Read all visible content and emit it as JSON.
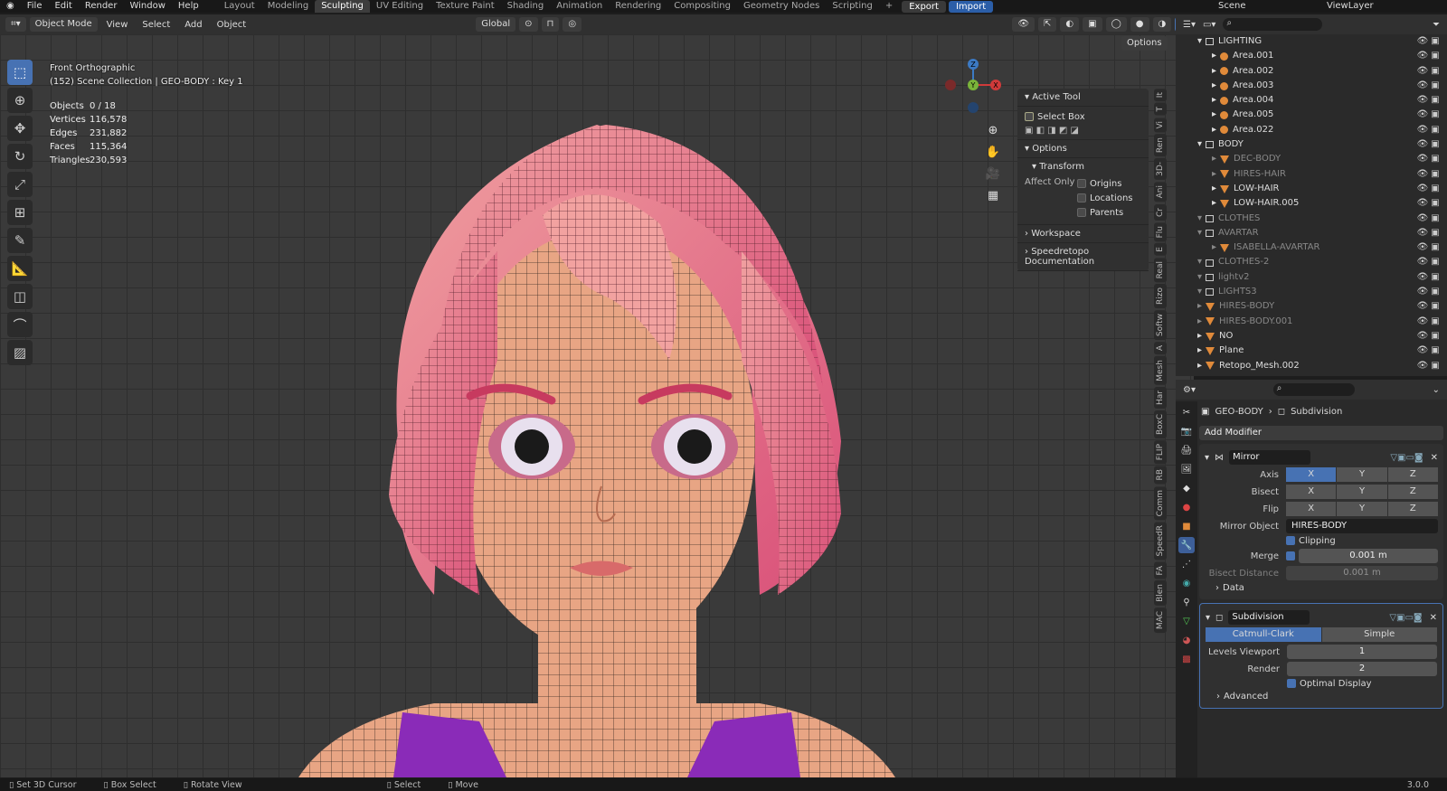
{
  "topbar": {
    "menus": [
      "File",
      "Edit",
      "Render",
      "Window",
      "Help"
    ],
    "workspaces": [
      "Layout",
      "Modeling",
      "Sculpting",
      "UV Editing",
      "Texture Paint",
      "Shading",
      "Animation",
      "Rendering",
      "Compositing",
      "Geometry Nodes",
      "Scripting"
    ],
    "active_workspace": "Sculpting",
    "export_label": "Export",
    "import_label": "Import",
    "scene_label": "Scene",
    "viewlayer_label": "ViewLayer"
  },
  "viewport_header": {
    "mode": "Object Mode",
    "menus": [
      "View",
      "Select",
      "Add",
      "Object"
    ],
    "orientation": "Global",
    "options_label": "Options"
  },
  "viewport": {
    "view_name": "Front Orthographic",
    "collection_info": "(152) Scene Collection | GEO-BODY : Key 1",
    "stats": [
      {
        "k": "Objects",
        "v": "0 / 18"
      },
      {
        "k": "Vertices",
        "v": "116,578"
      },
      {
        "k": "Edges",
        "v": "231,882"
      },
      {
        "k": "Faces",
        "v": "115,364"
      },
      {
        "k": "Triangles",
        "v": "230,593"
      }
    ],
    "gizmo": {
      "x": "X",
      "y": "Y",
      "z": "Z"
    }
  },
  "npanel": {
    "active_tool_title": "Active Tool",
    "tool_name": "Select Box",
    "options_title": "Options",
    "transform_title": "Transform",
    "affect_only": "Affect Only",
    "checks": [
      "Origins",
      "Locations",
      "Parents"
    ],
    "workspace_title": "Workspace",
    "doc_title": "Speedretopo Documentation",
    "tabs": [
      "It",
      "T",
      "Vi",
      "Ren",
      "3D-",
      "Ani",
      "Cr",
      "Flu",
      "E",
      "Real",
      "Rizo",
      "Softw",
      "A",
      "Mesh",
      "Har",
      "BoxC",
      "FLIP",
      "RB",
      "Comm",
      "SpeedR",
      "FA",
      "Blen",
      "MAC"
    ]
  },
  "outliner": {
    "rows": [
      {
        "name": "LIGHTING",
        "type": "coll",
        "indent": 1,
        "dim": false
      },
      {
        "name": "Area.001",
        "type": "light",
        "indent": 2,
        "dim": false
      },
      {
        "name": "Area.002",
        "type": "light",
        "indent": 2,
        "dim": false
      },
      {
        "name": "Area.003",
        "type": "light",
        "indent": 2,
        "dim": false
      },
      {
        "name": "Area.004",
        "type": "light",
        "indent": 2,
        "dim": false
      },
      {
        "name": "Area.005",
        "type": "light",
        "indent": 2,
        "dim": false
      },
      {
        "name": "Area.022",
        "type": "light",
        "indent": 2,
        "dim": false
      },
      {
        "name": "BODY",
        "type": "coll",
        "indent": 1,
        "dim": false
      },
      {
        "name": "DEC-BODY",
        "type": "mesh",
        "indent": 2,
        "dim": true
      },
      {
        "name": "HIRES-HAIR",
        "type": "mesh",
        "indent": 2,
        "dim": true
      },
      {
        "name": "LOW-HAIR",
        "type": "mesh",
        "indent": 2,
        "dim": false
      },
      {
        "name": "LOW-HAIR.005",
        "type": "mesh",
        "indent": 2,
        "dim": false
      },
      {
        "name": "CLOTHES",
        "type": "coll",
        "indent": 1,
        "dim": true
      },
      {
        "name": "AVARTAR",
        "type": "coll",
        "indent": 1,
        "dim": true
      },
      {
        "name": "ISABELLA-AVARTAR",
        "type": "mesh",
        "indent": 2,
        "dim": true
      },
      {
        "name": "CLOTHES-2",
        "type": "coll",
        "indent": 1,
        "dim": true
      },
      {
        "name": "lightv2",
        "type": "coll",
        "indent": 1,
        "dim": true
      },
      {
        "name": "LIGHTS3",
        "type": "coll",
        "indent": 1,
        "dim": true
      },
      {
        "name": "HIRES-BODY",
        "type": "mesh",
        "indent": 1,
        "dim": true
      },
      {
        "name": "HIRES-BODY.001",
        "type": "mesh",
        "indent": 1,
        "dim": true
      },
      {
        "name": "NO",
        "type": "mesh",
        "indent": 1,
        "dim": false
      },
      {
        "name": "Plane",
        "type": "mesh",
        "indent": 1,
        "dim": false
      },
      {
        "name": "Retopo_Mesh.002",
        "type": "mesh",
        "indent": 1,
        "dim": false
      }
    ]
  },
  "properties": {
    "object_name": "GEO-BODY",
    "modifier_crumb": "Subdivision",
    "add_modifier": "Add Modifier",
    "mirror": {
      "name": "Mirror",
      "axis_label": "Axis",
      "bisect_label": "Bisect",
      "flip_label": "Flip",
      "xyz": [
        "X",
        "Y",
        "Z"
      ],
      "mirror_object_label": "Mirror Object",
      "mirror_object": "HIRES-BODY",
      "clipping_label": "Clipping",
      "merge_label": "Merge",
      "merge_value": "0.001 m",
      "bisect_distance_label": "Bisect Distance",
      "bisect_distance_value": "0.001 m",
      "data_label": "Data"
    },
    "subdivision": {
      "name": "Subdivision",
      "catmull": "Catmull-Clark",
      "simple": "Simple",
      "levels_viewport_label": "Levels Viewport",
      "levels_viewport": "1",
      "render_label": "Render",
      "render": "2",
      "optimal_label": "Optimal Display",
      "advanced_label": "Advanced"
    }
  },
  "statusbar": {
    "items": [
      "Set 3D Cursor",
      "Box Select",
      "Rotate View",
      "Select",
      "Move"
    ],
    "version": "3.0.0"
  },
  "colors": {
    "accent": "#4772b3",
    "object_orange": "#e08a3a",
    "hair_pink": "#e8707f",
    "skin": "#e8a584"
  }
}
